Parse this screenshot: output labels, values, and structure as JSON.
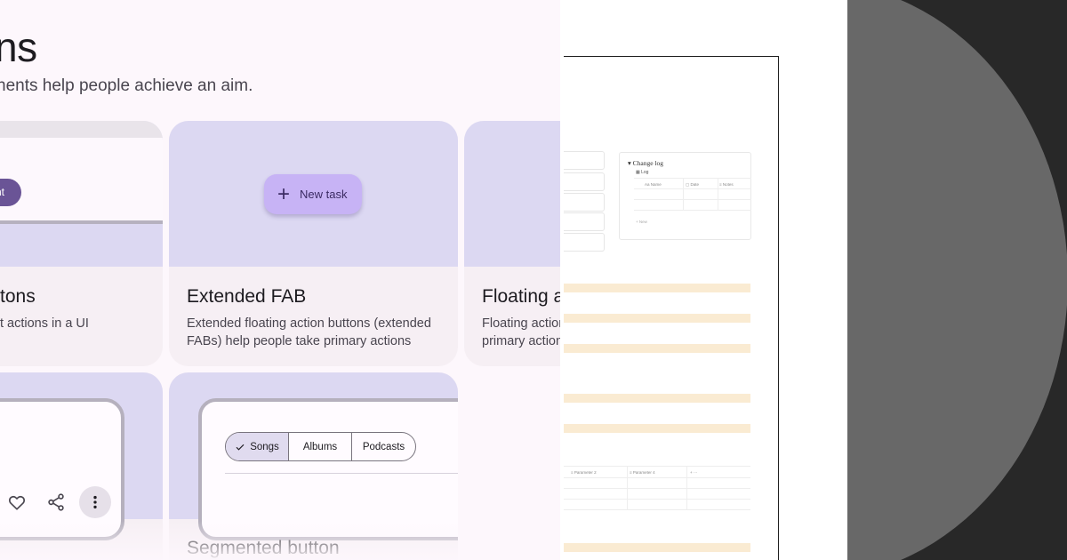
{
  "page": {
    "title": "ns",
    "subtitle": "nents help people achieve an aim."
  },
  "cards": {
    "common": {
      "title": "tons",
      "desc": "t actions in a UI",
      "pill": "nt"
    },
    "extended_fab": {
      "title": "Extended FAB",
      "desc_line1": "Extended floating action buttons (extended",
      "desc_line2": "FABs) help people take primary actions",
      "fab_label": "New task"
    },
    "fab": {
      "title": "Floating a",
      "desc_line1": "Floating action",
      "desc_line2": "primary actions"
    },
    "icon_buttons": {
      "icons": [
        "heart-icon",
        "share-icon",
        "more-vert-icon"
      ]
    },
    "segmented": {
      "title": "Segmented button",
      "segments": [
        "Songs",
        "Albums",
        "Podcasts"
      ],
      "selected": "Songs"
    }
  },
  "doc": {
    "changelog_title": "Change log",
    "log_label": "Log",
    "columns": [
      "Name",
      "Date",
      "Notes"
    ],
    "new_label": "New",
    "param_columns": [
      "Parameter 2",
      "Parameter 4"
    ],
    "highlight_color": "#faebd2"
  },
  "colors": {
    "m3_surface": "#fdf7fc",
    "card": "#f6eff4",
    "art": "#dcd8f2",
    "fab": "#c7b3f5",
    "pill": "#6a5496",
    "dark_bg": "#282828",
    "disc": "#686868"
  }
}
